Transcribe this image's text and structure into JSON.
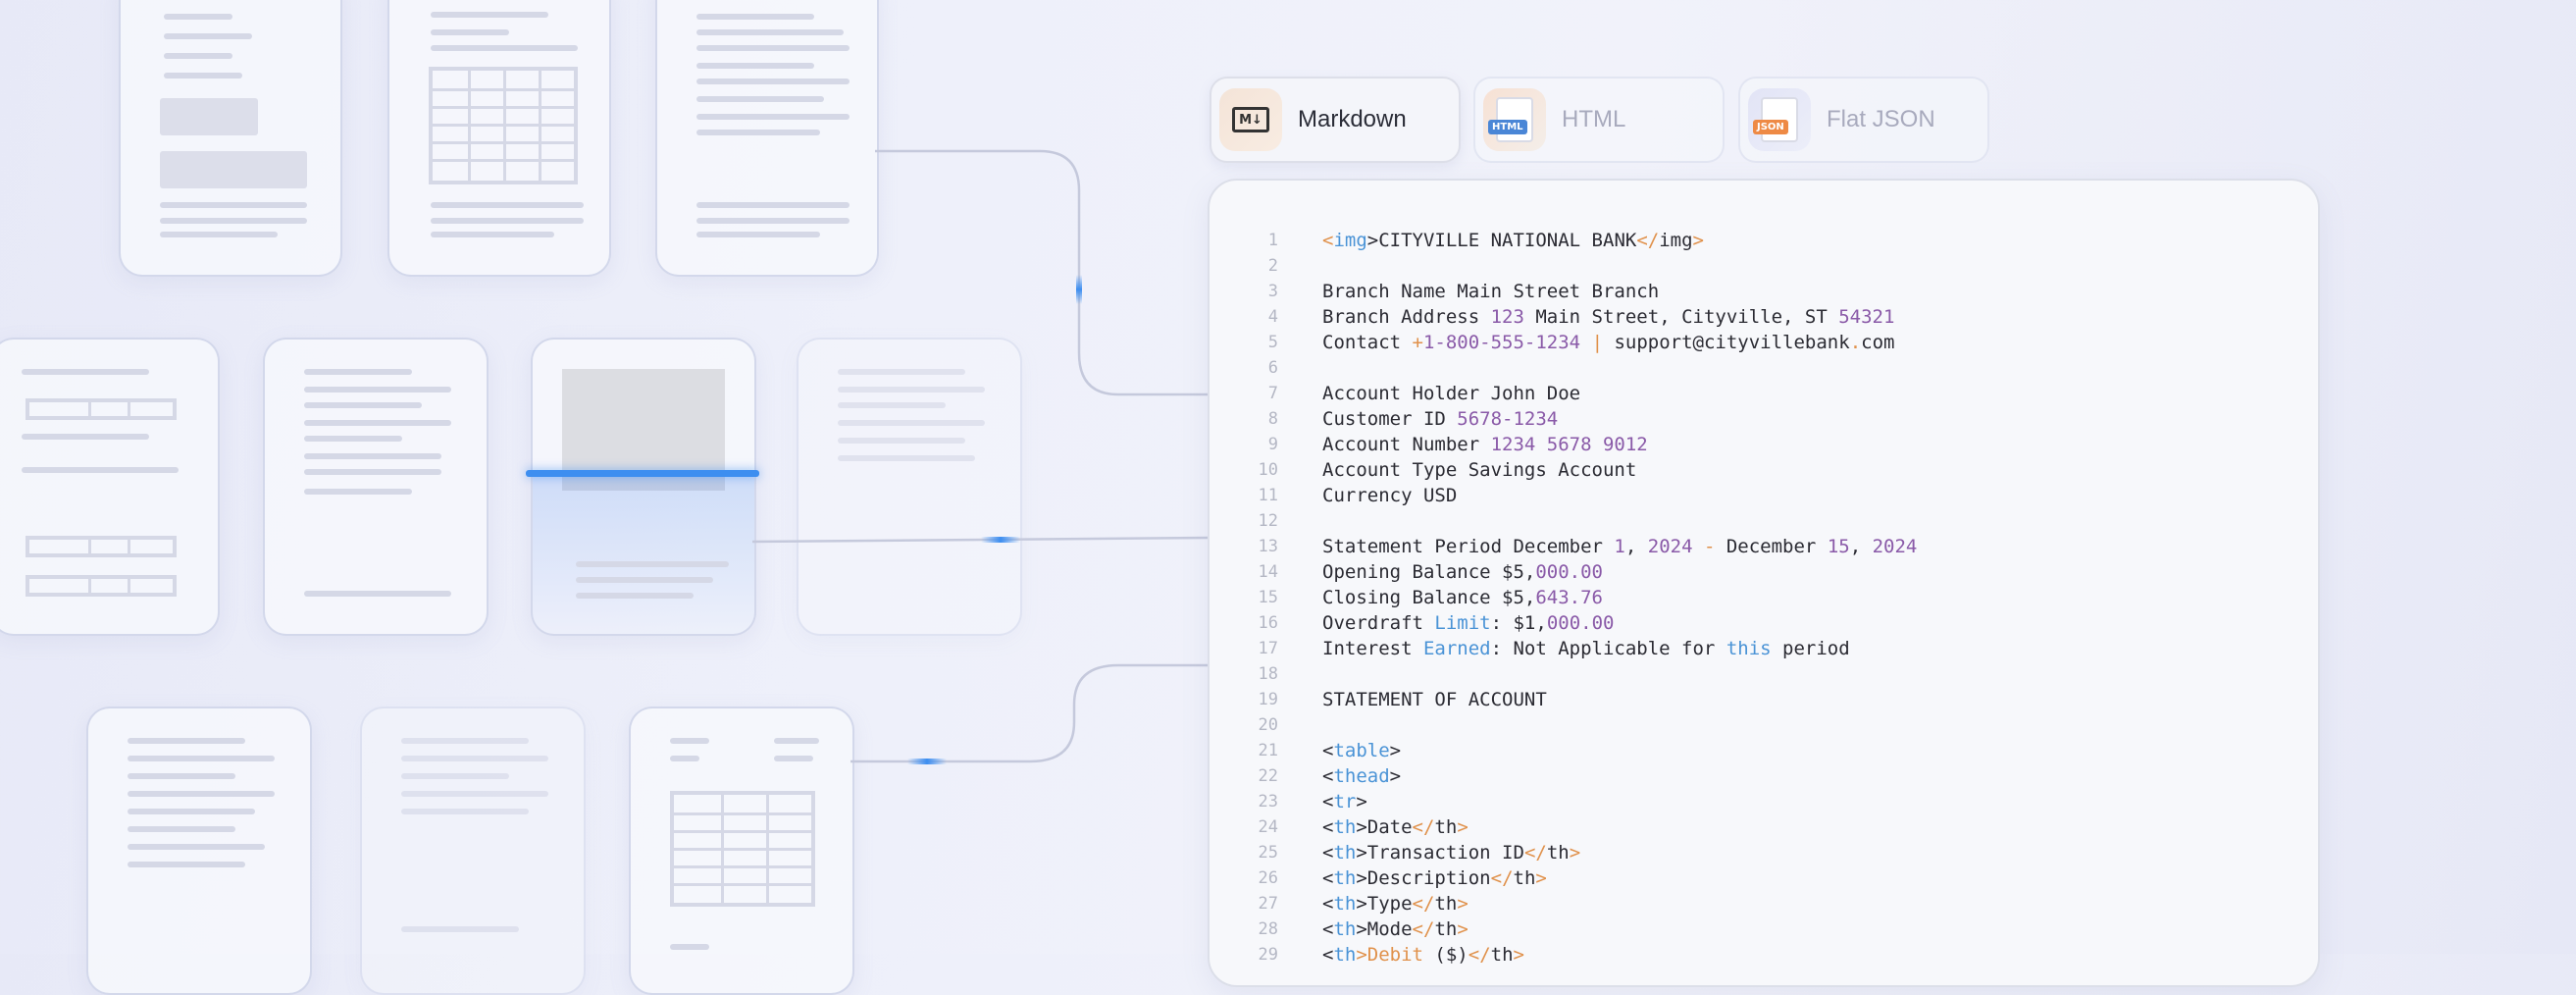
{
  "tabs": [
    {
      "label": "Markdown",
      "icon": "markdown-file-icon",
      "badge": "M↓",
      "active": true
    },
    {
      "label": "HTML",
      "icon": "html-file-icon",
      "badge": "HTML",
      "active": false
    },
    {
      "label": "Flat JSON",
      "icon": "json-file-icon",
      "badge": "JSON",
      "active": false
    }
  ],
  "colors": {
    "tag": "#4a93d6",
    "bracket": "#e0914b",
    "number": "#8a5aa8",
    "text": "#2b2b33",
    "scan": "#3d8ef0"
  },
  "code": [
    {
      "n": "1",
      "segs": [
        [
          "t-br",
          "<"
        ],
        [
          "t-tag",
          "img"
        ],
        [
          "",
          "&gt;CITYVILLE NATIONAL BANK"
        ],
        [
          "t-br",
          "</"
        ],
        [
          "",
          "img"
        ],
        [
          "t-br",
          ">"
        ]
      ]
    },
    {
      "n": "2",
      "segs": []
    },
    {
      "n": "3",
      "segs": [
        [
          "",
          "Branch Name Main Street Branch"
        ]
      ]
    },
    {
      "n": "4",
      "segs": [
        [
          "",
          "Branch Address "
        ],
        [
          "t-num",
          "123"
        ],
        [
          "",
          " Main Street, Cityville, ST "
        ],
        [
          "t-num",
          "54321"
        ]
      ]
    },
    {
      "n": "5",
      "segs": [
        [
          "",
          "Contact "
        ],
        [
          "t-op",
          "+"
        ],
        [
          "t-num",
          "1-800-555-1234"
        ],
        [
          "t-op",
          " |"
        ],
        [
          "",
          " support@cityvillebank"
        ],
        [
          "t-op",
          "."
        ],
        [
          "",
          "com"
        ]
      ]
    },
    {
      "n": "6",
      "segs": []
    },
    {
      "n": "7",
      "segs": [
        [
          "",
          "Account Holder John Doe"
        ]
      ]
    },
    {
      "n": "8",
      "segs": [
        [
          "",
          "Customer ID "
        ],
        [
          "t-num",
          "5678-1234"
        ]
      ]
    },
    {
      "n": "9",
      "segs": [
        [
          "",
          "Account Number "
        ],
        [
          "t-num",
          "1234 5678 9012"
        ]
      ]
    },
    {
      "n": "10",
      "segs": [
        [
          "",
          "Account Type Savings Account"
        ]
      ]
    },
    {
      "n": "11",
      "segs": [
        [
          "",
          "Currency USD"
        ]
      ]
    },
    {
      "n": "12",
      "segs": []
    },
    {
      "n": "13",
      "segs": [
        [
          "",
          "Statement Period December "
        ],
        [
          "t-num",
          "1"
        ],
        [
          "",
          ", "
        ],
        [
          "t-num",
          "2024"
        ],
        [
          "t-op",
          " -"
        ],
        [
          "",
          " December "
        ],
        [
          "t-num",
          "15"
        ],
        [
          "",
          ", "
        ],
        [
          "t-num",
          "2024"
        ]
      ]
    },
    {
      "n": "14",
      "segs": [
        [
          "",
          "Opening Balance $"
        ],
        [
          "",
          "5,"
        ],
        [
          "t-num",
          "000.00"
        ]
      ]
    },
    {
      "n": "15",
      "segs": [
        [
          "",
          "Closing Balance $"
        ],
        [
          "",
          "5,"
        ],
        [
          "t-num",
          "643.76"
        ]
      ]
    },
    {
      "n": "16",
      "segs": [
        [
          "",
          "Overdraft "
        ],
        [
          "t-kw",
          "Limit"
        ],
        [
          "",
          ": $"
        ],
        [
          "",
          "1,"
        ],
        [
          "t-num",
          "000.00"
        ]
      ]
    },
    {
      "n": "17",
      "segs": [
        [
          "",
          "Interest "
        ],
        [
          "t-kw",
          "Earned"
        ],
        [
          "",
          ": Not Applicable for "
        ],
        [
          "t-kw",
          "this"
        ],
        [
          "",
          " period"
        ]
      ]
    },
    {
      "n": "18",
      "segs": []
    },
    {
      "n": "19",
      "segs": [
        [
          "",
          "STATEMENT OF ACCOUNT"
        ]
      ]
    },
    {
      "n": "20",
      "segs": []
    },
    {
      "n": "21",
      "segs": [
        [
          "",
          "<"
        ],
        [
          "t-tag",
          "table"
        ],
        [
          "",
          ">"
        ]
      ]
    },
    {
      "n": "22",
      "segs": [
        [
          "",
          "<"
        ],
        [
          "t-tag",
          "thead"
        ],
        [
          "",
          ">"
        ]
      ]
    },
    {
      "n": "23",
      "segs": [
        [
          "",
          "<"
        ],
        [
          "t-tag",
          "tr"
        ],
        [
          "",
          ">"
        ]
      ]
    },
    {
      "n": "24",
      "segs": [
        [
          "",
          "<"
        ],
        [
          "t-tag",
          "th"
        ],
        [
          "",
          ">Date"
        ],
        [
          "t-br",
          "</"
        ],
        [
          "",
          "th"
        ],
        [
          "t-br",
          ">"
        ]
      ]
    },
    {
      "n": "25",
      "segs": [
        [
          "",
          "<"
        ],
        [
          "t-tag",
          "th"
        ],
        [
          "",
          ">Transaction ID"
        ],
        [
          "t-br",
          "</"
        ],
        [
          "",
          "th"
        ],
        [
          "t-br",
          ">"
        ]
      ]
    },
    {
      "n": "26",
      "segs": [
        [
          "",
          "<"
        ],
        [
          "t-tag",
          "th"
        ],
        [
          "",
          ">Description"
        ],
        [
          "t-br",
          "</"
        ],
        [
          "",
          "th"
        ],
        [
          "t-br",
          ">"
        ]
      ]
    },
    {
      "n": "27",
      "segs": [
        [
          "",
          "<"
        ],
        [
          "t-tag",
          "th"
        ],
        [
          "",
          ">Type"
        ],
        [
          "t-br",
          "</"
        ],
        [
          "",
          "th"
        ],
        [
          "t-br",
          ">"
        ]
      ]
    },
    {
      "n": "28",
      "segs": [
        [
          "",
          "<"
        ],
        [
          "t-tag",
          "th"
        ],
        [
          "",
          ">Mode"
        ],
        [
          "t-br",
          "</"
        ],
        [
          "",
          "th"
        ],
        [
          "t-br",
          ">"
        ]
      ]
    },
    {
      "n": "29",
      "segs": [
        [
          "",
          "<"
        ],
        [
          "t-tag",
          "th"
        ],
        [
          "t-op",
          ">Debit"
        ],
        [
          "",
          " ($)"
        ],
        [
          "t-br",
          "</"
        ],
        [
          "",
          "th"
        ],
        [
          "t-br",
          ">"
        ]
      ]
    }
  ]
}
